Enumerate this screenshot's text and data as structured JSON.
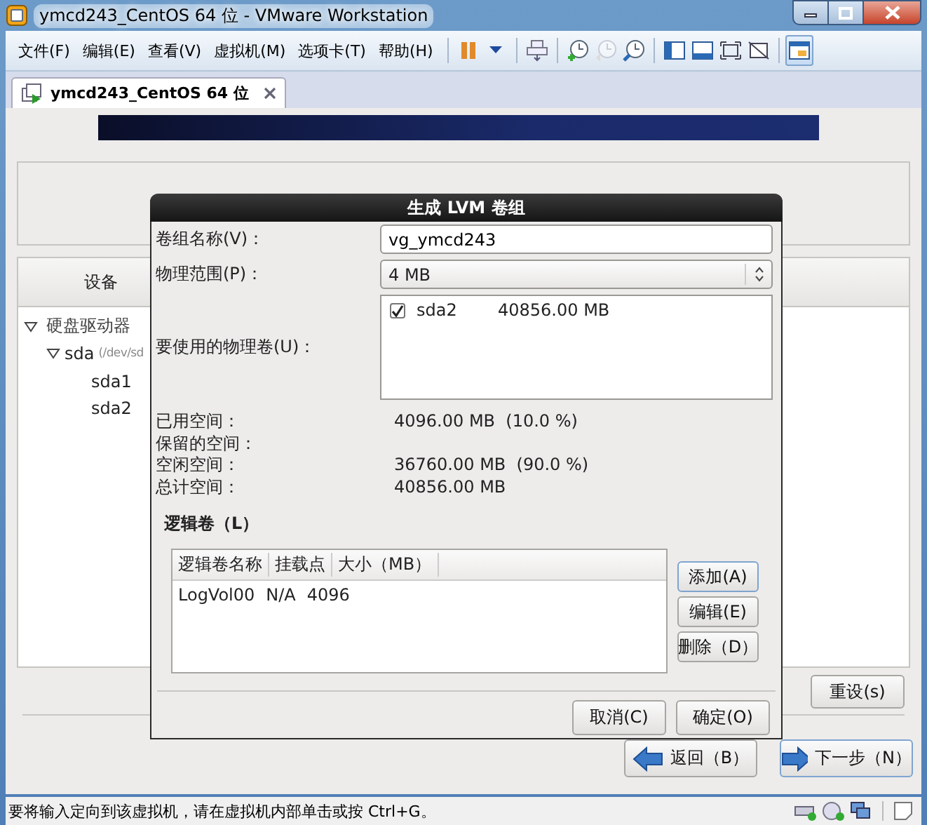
{
  "window": {
    "title": "ymcd243_CentOS 64 位 - VMware Workstation"
  },
  "menu": [
    "文件(F)",
    "编辑(E)",
    "查看(V)",
    "虚拟机(M)",
    "选项卡(T)",
    "帮助(H)"
  ],
  "toolbar": [
    {
      "kind": "pause",
      "pressed": false,
      "disabled": false
    },
    {
      "kind": "dropdown",
      "pressed": false,
      "disabled": false
    },
    {
      "kind": "send-keys",
      "pressed": false,
      "disabled": false
    },
    {
      "kind": "snapshot-take",
      "pressed": false,
      "disabled": false
    },
    {
      "kind": "snapshot-revert",
      "pressed": false,
      "disabled": true
    },
    {
      "kind": "snapshot-manager",
      "pressed": false,
      "disabled": false
    },
    {
      "kind": "sidebar",
      "pressed": false,
      "disabled": false
    },
    {
      "kind": "thumbnail",
      "pressed": false,
      "disabled": false
    },
    {
      "kind": "fullscreen",
      "pressed": false,
      "disabled": false
    },
    {
      "kind": "unity",
      "pressed": false,
      "disabled": false
    },
    {
      "kind": "console-view",
      "pressed": true,
      "disabled": false
    }
  ],
  "tabs": [
    {
      "label": "ymcd243_CentOS 64 位",
      "selected": true
    }
  ],
  "installer": {
    "device_column": "设备",
    "tree": [
      {
        "label": "硬盘驱动器",
        "expanded": true,
        "children": [
          {
            "label": "sda",
            "path": "(/dev/sd",
            "expanded": true,
            "children": [
              {
                "label": "sda1"
              },
              {
                "label": "sda2"
              }
            ]
          }
        ]
      }
    ],
    "reset_button": "重设(s)",
    "back_button": "返回（B）",
    "next_button": "下一步（N）"
  },
  "dialog": {
    "title": "生成 LVM 卷组",
    "name_label": "卷组名称(V)：",
    "name_value": "vg_ymcd243",
    "extent_label": "物理范围(P)：",
    "extent_value": "4 MB",
    "pv_label": "要使用的物理卷(U)：",
    "physical_volumes": [
      {
        "name": "sda2",
        "size": "40856.00 MB",
        "checked": true
      }
    ],
    "stats": [
      {
        "label": "已用空间：",
        "value": "4096.00 MB  (10.0 %)"
      },
      {
        "label": "保留的空间："
      },
      {
        "label": "空闲空间：",
        "value": "36760.00 MB  (90.0 %)"
      },
      {
        "label": "总计空间：",
        "value": "40856.00 MB"
      }
    ],
    "lv_section": "逻辑卷（L）",
    "lv_columns": [
      "逻辑卷名称",
      "挂载点",
      "大小（MB）"
    ],
    "lv_rows": [
      [
        "LogVol00",
        "N/A",
        "4096"
      ]
    ],
    "lv_buttons": [
      "添加(A)",
      "编辑(E)",
      "删除（D）"
    ],
    "cancel_button": "取消(C)",
    "ok_button": "确定(O)"
  },
  "status_bar": {
    "message": "要将输入定向到该虚拟机，请在虚拟机内部单击或按 Ctrl+G。"
  }
}
